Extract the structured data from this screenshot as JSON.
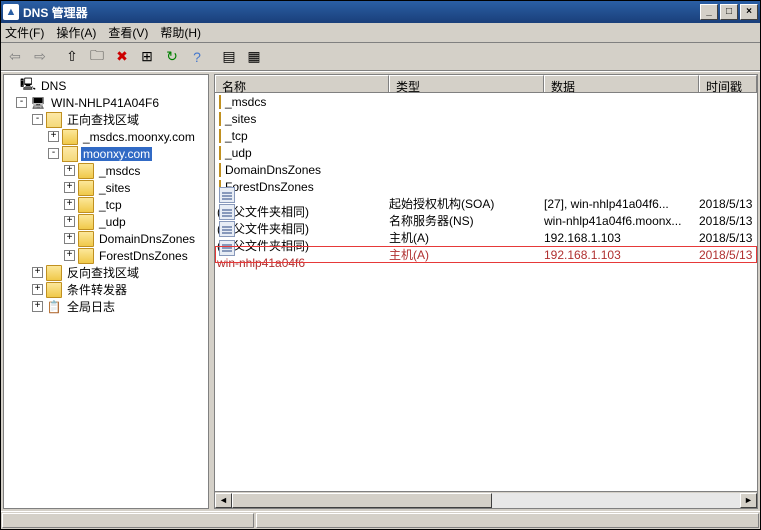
{
  "window": {
    "title": "DNS 管理器",
    "min": "_",
    "max": "□",
    "close": "×"
  },
  "menu": {
    "file": "文件(F)",
    "action": "操作(A)",
    "view": "查看(V)",
    "help": "帮助(H)"
  },
  "toolbar_icons": [
    "⇦",
    "⇨",
    "⇧",
    "🗀",
    "✖",
    "⊞",
    "↻",
    "?",
    "▤",
    "▦"
  ],
  "tree": {
    "root": "DNS",
    "server": "WIN-NHLP41A04F6",
    "fwd": "正向查找区域",
    "msdcs_zone": "_msdcs.moonxy.com",
    "zone": "moonxy.com",
    "sub": [
      "_msdcs",
      "_sites",
      "_tcp",
      "_udp",
      "DomainDnsZones",
      "ForestDnsZones"
    ],
    "rev": "反向查找区域",
    "cond": "条件转发器",
    "log": "全局日志"
  },
  "columns": {
    "name": "名称",
    "type": "类型",
    "data": "数据",
    "ts": "时间戳"
  },
  "folders": [
    "_msdcs",
    "_sites",
    "_tcp",
    "_udp",
    "DomainDnsZones",
    "ForestDnsZones"
  ],
  "records": [
    {
      "name": "(与父文件夹相同)",
      "type": "起始授权机构(SOA)",
      "data": "[27], win-nhlp41a04f6...",
      "ts": "2018/5/13"
    },
    {
      "name": "(与父文件夹相同)",
      "type": "名称服务器(NS)",
      "data": "win-nhlp41a04f6.moonx...",
      "ts": "2018/5/13"
    },
    {
      "name": "(与父文件夹相同)",
      "type": "主机(A)",
      "data": "192.168.1.103",
      "ts": "2018/5/13"
    },
    {
      "name": "win-nhlp41a04f6",
      "type": "主机(A)",
      "data": "192.168.1.103",
      "ts": "2018/5/13"
    }
  ]
}
